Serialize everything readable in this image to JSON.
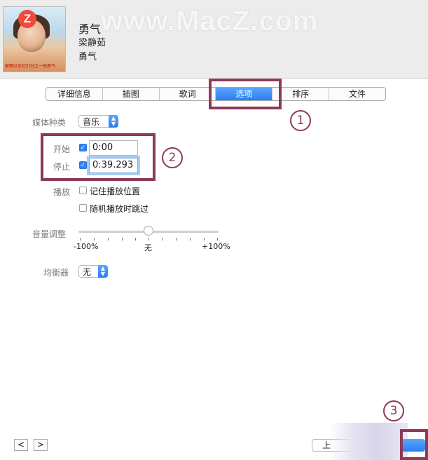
{
  "watermark": {
    "logo_letter": "Z",
    "text": "www.MacZ.com"
  },
  "header": {
    "title": "勇气",
    "artist": "梁静茹",
    "album": "勇气",
    "art_caption": "爱情以及它们分之一的勇气"
  },
  "tabs": [
    {
      "label": "详细信息",
      "active": false
    },
    {
      "label": "插图",
      "active": false
    },
    {
      "label": "歌词",
      "active": false
    },
    {
      "label": "选项",
      "active": true
    },
    {
      "label": "排序",
      "active": false
    },
    {
      "label": "文件",
      "active": false
    }
  ],
  "options": {
    "media_kind_label": "媒体种类",
    "media_kind_value": "音乐",
    "start_label": "开始",
    "start_checked": true,
    "start_value": "0:00",
    "stop_label": "停止",
    "stop_checked": true,
    "stop_value": "0:39.293",
    "playback_label": "播放",
    "remember_position_label": "记住播放位置",
    "remember_position_checked": false,
    "skip_shuffle_label": "随机播放时跳过",
    "skip_shuffle_checked": false,
    "volume_label": "音量调整",
    "volume_min_label": "-100%",
    "volume_mid_label": "无",
    "volume_max_label": "+100%",
    "volume_value_percent": 0,
    "equalizer_label": "均衡器",
    "equalizer_value": "无"
  },
  "annotations": {
    "step1": "1",
    "step2": "2",
    "step3": "3"
  },
  "footer": {
    "prev_label": "<",
    "next_label": ">",
    "partial_button_label": "上"
  },
  "colors": {
    "accent_blue": "#2a7ef2",
    "annotation_marker": "#8d3a57",
    "watermark_logo": "#ef4a3a"
  }
}
